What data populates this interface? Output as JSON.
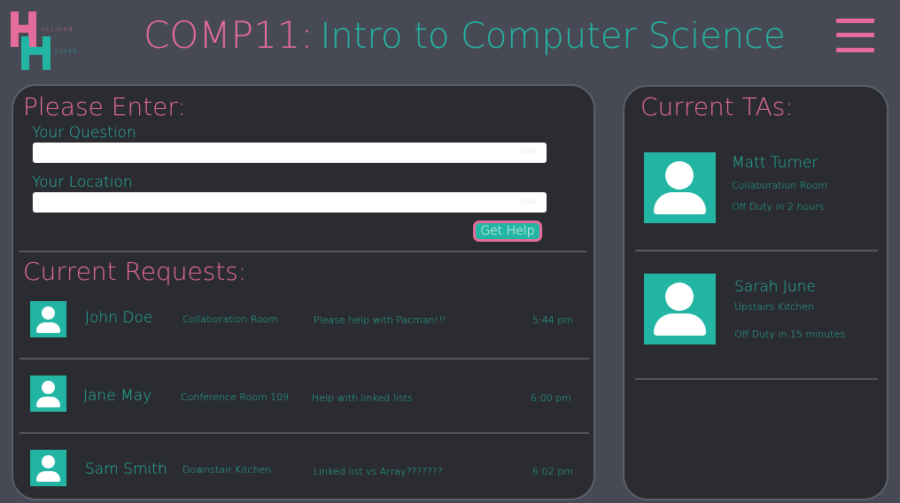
{
  "logo": {
    "letter": "H",
    "text_top": "ALLIGAN",
    "text_bottom": "ELPER"
  },
  "header": {
    "course_code": "COMP11:",
    "course_name": "Intro to Computer Science"
  },
  "menu": {
    "icon": "hamburger-menu-icon"
  },
  "form": {
    "heading": "Please Enter:",
    "question_label": "Your Question",
    "question_value": "",
    "question_counter": "0/50",
    "location_label": "Your Location",
    "location_value": "",
    "location_counter": "0/50",
    "submit_label": "Get Help"
  },
  "requests": {
    "heading": "Current Requests:",
    "items": [
      {
        "name": "John Doe",
        "location": "Collaboration Room",
        "question": "Please help with Pacman!!!",
        "time": "5:44 pm"
      },
      {
        "name": "Jane May",
        "location": "Conference Room 109",
        "question": "Help with linked lists",
        "time": "6:00 pm"
      },
      {
        "name": "Sam Smith",
        "location": "Downstair Kitchen",
        "question": "Linked list vs Array???????",
        "time": "6:02 pm"
      }
    ]
  },
  "tas": {
    "heading": "Current TAs:",
    "items": [
      {
        "name": "Matt Turner",
        "location": "Collaboration Room",
        "status": "Off Duty in 2 hours"
      },
      {
        "name": "Sarah June",
        "location": "Upstairs Kitchen",
        "status": "Off Duty in 15 minutes"
      }
    ]
  },
  "colors": {
    "background": "#474a55",
    "panel": "#2b2c31",
    "pink": "#e56b9a",
    "teal": "#23b5a4"
  }
}
